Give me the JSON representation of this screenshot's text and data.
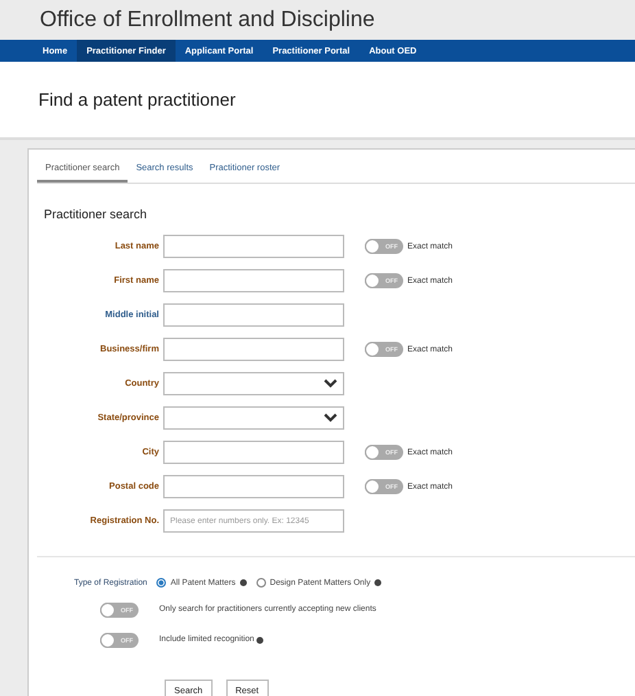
{
  "site_title": "Office of Enrollment and Discipline",
  "nav": [
    {
      "label": "Home",
      "selected": false
    },
    {
      "label": "Practitioner Finder",
      "selected": true
    },
    {
      "label": "Applicant Portal",
      "selected": false
    },
    {
      "label": "Practitioner Portal",
      "selected": false
    },
    {
      "label": "About OED",
      "selected": false
    }
  ],
  "page_title": "Find a patent practitioner",
  "tabs": [
    {
      "label": "Practitioner search",
      "selected": true
    },
    {
      "label": "Search results",
      "selected": false
    },
    {
      "label": "Practitioner roster",
      "selected": false
    }
  ],
  "section_title": "Practitioner search",
  "fields": [
    {
      "label": "Last name",
      "kind": "text",
      "color": "#8a4b0f",
      "exact_match": {
        "on": false,
        "switch_text": "OFF",
        "label": "Exact match"
      }
    },
    {
      "label": "First name",
      "kind": "text",
      "color": "#8a4b0f",
      "exact_match": {
        "on": false,
        "switch_text": "OFF",
        "label": "Exact match"
      }
    },
    {
      "label": "Middle initial",
      "kind": "text",
      "color": "#2f5d8c"
    },
    {
      "label": "Business/firm",
      "kind": "text",
      "color": "#8a4b0f",
      "exact_match": {
        "on": false,
        "switch_text": "OFF",
        "label": "Exact match"
      }
    },
    {
      "label": "Country",
      "kind": "select",
      "color": "#8a4b0f"
    },
    {
      "label": "State/province",
      "kind": "select",
      "color": "#8a4b0f"
    },
    {
      "label": "City",
      "kind": "text",
      "color": "#8a4b0f",
      "exact_match": {
        "on": false,
        "switch_text": "OFF",
        "label": "Exact match"
      }
    },
    {
      "label": "Postal code",
      "kind": "text",
      "color": "#8a4b0f",
      "exact_match": {
        "on": false,
        "switch_text": "OFF",
        "label": "Exact match"
      }
    },
    {
      "label": "Registration No.",
      "kind": "text",
      "color": "#8a4b0f",
      "placeholder": "Please enter numbers only. Ex: 12345"
    }
  ],
  "registration_type": {
    "label": "Type of Registration",
    "options": [
      {
        "label": "All Patent Matters",
        "selected": true,
        "info": true
      },
      {
        "label": "Design Patent Matters Only",
        "selected": false,
        "info": true
      }
    ]
  },
  "options": [
    {
      "on": false,
      "switch_text": "OFF",
      "label": "Only search for practitioners currently accepting new clients",
      "info": false
    },
    {
      "on": false,
      "switch_text": "OFF",
      "label": "Include limited recognition",
      "info": true
    }
  ],
  "buttons": [
    "Search",
    "Reset"
  ]
}
